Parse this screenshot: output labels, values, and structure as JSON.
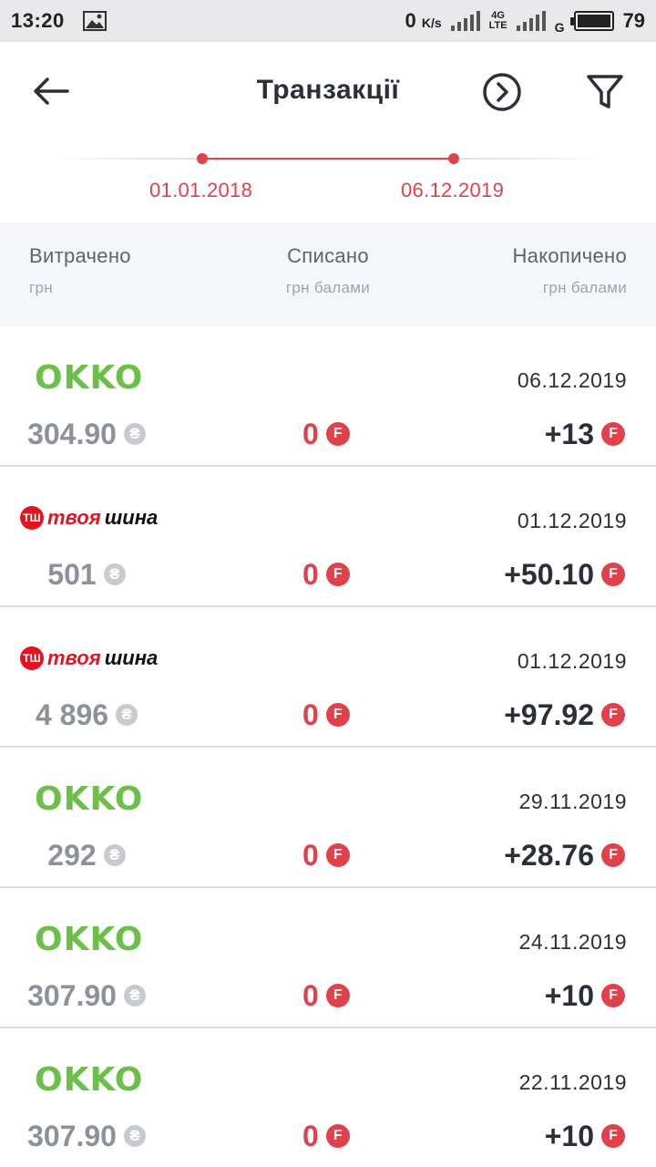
{
  "status": {
    "time": "13:20",
    "speed_value": "0",
    "speed_unit": "K/s",
    "net1": "4G",
    "net1_sub": "LTE",
    "net2": "G",
    "battery": "79"
  },
  "header": {
    "title": "Транзакції",
    "date_from": "01.01.2018",
    "date_to": "06.12.2019"
  },
  "summary": {
    "spent_label": "Витрачено",
    "spent_unit": "грн",
    "written_label": "Списано",
    "written_unit": "грн балами",
    "earned_label": "Накопичено",
    "earned_unit": "грн балами"
  },
  "transactions": [
    {
      "merchant": "OKKO",
      "date": "06.12.2019",
      "spent": "304.90",
      "written": "0",
      "earned": "+13"
    },
    {
      "merchant": "твоя шина",
      "date": "01.12.2019",
      "spent": "501",
      "written": "0",
      "earned": "+50.10"
    },
    {
      "merchant": "твоя шина",
      "date": "01.12.2019",
      "spent": "4 896",
      "written": "0",
      "earned": "+97.92"
    },
    {
      "merchant": "OKKO",
      "date": "29.11.2019",
      "spent": "292",
      "written": "0",
      "earned": "+28.76"
    },
    {
      "merchant": "OKKO",
      "date": "24.11.2019",
      "spent": "307.90",
      "written": "0",
      "earned": "+10"
    },
    {
      "merchant": "OKKO",
      "date": "22.11.2019",
      "spent": "307.90",
      "written": "0",
      "earned": "+10"
    }
  ],
  "icons": {
    "hryvnia": "₴",
    "points": "F",
    "tshina_badge": "ТШ"
  },
  "colors": {
    "accent_red": "#e0414b",
    "okko_green": "#6cc04a",
    "tshina_red": "#e3141f"
  }
}
